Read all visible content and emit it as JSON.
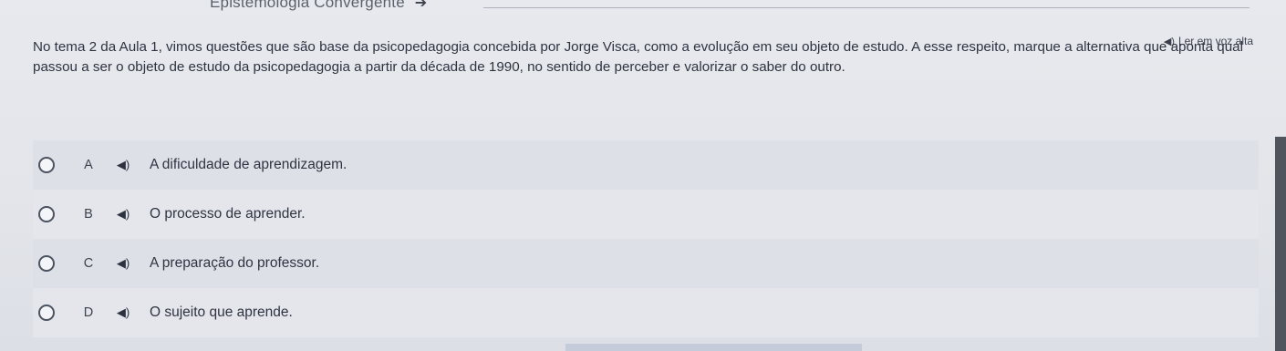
{
  "header": {
    "title": "Epistemologia Convergente",
    "arrow": "➔"
  },
  "read_aloud": {
    "label": "Ler em voz alta",
    "icon": "speaker-icon"
  },
  "question": {
    "text": "No tema 2 da Aula 1, vimos questões que são base da psicopedagogia concebida por Jorge Visca, como a evolução em seu objeto de estudo. A esse respeito, marque a alternativa que aponta qual passou a ser o objeto de estudo da psicopedagogia a partir da década de 1990, no sentido de perceber e valorizar o saber do outro."
  },
  "options": [
    {
      "letter": "A",
      "text": "A dificuldade de aprendizagem.",
      "selected": false
    },
    {
      "letter": "B",
      "text": "O processo de aprender.",
      "selected": false
    },
    {
      "letter": "C",
      "text": "A preparação do professor.",
      "selected": false
    },
    {
      "letter": "D",
      "text": "O sujeito que aprende.",
      "selected": false
    }
  ],
  "icons": {
    "option_audio": "🔊",
    "read_aloud": "◀)"
  }
}
